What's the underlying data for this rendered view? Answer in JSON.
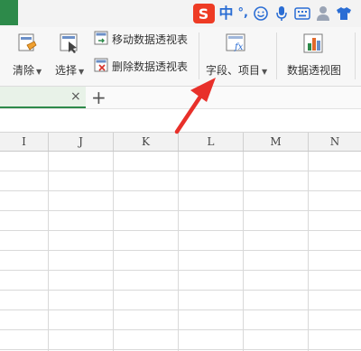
{
  "ime": {
    "logo": "S",
    "mode": "中",
    "punct": "°,"
  },
  "ribbon": {
    "clear_label": "清除",
    "select_label": "选择",
    "move_pivot_label": "移动数据透视表",
    "delete_pivot_label": "删除数据透视表",
    "fields_items_label": "字段、项目",
    "pivot_chart_label": "数据透视图"
  },
  "tabs": {
    "close_symbol": "×",
    "add_symbol": "+"
  },
  "columns": [
    "I",
    "J",
    "K",
    "L",
    "M",
    "N"
  ],
  "colors": {
    "accent": "#2d8a4a",
    "annotation_arrow": "#e8302a"
  }
}
